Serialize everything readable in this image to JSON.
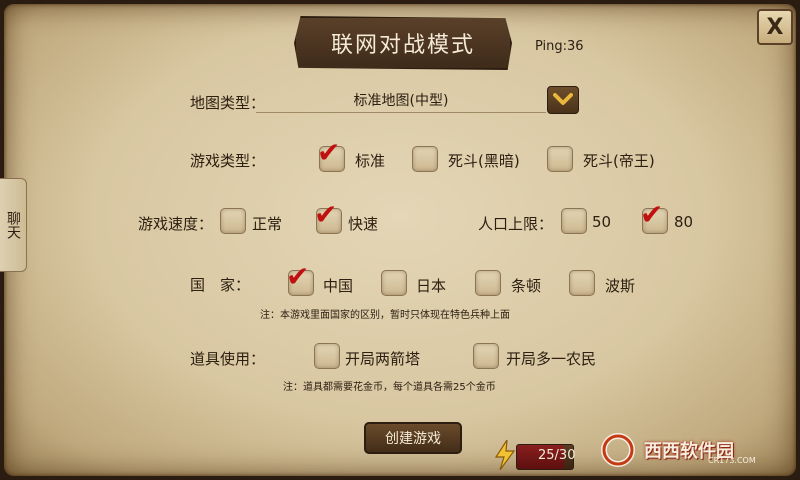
{
  "title": "联网对战模式",
  "ping": "Ping:36",
  "close_label": "X",
  "chat_tab": "聊天",
  "map": {
    "label": "地图类型：",
    "selected": "标准地图(中型)"
  },
  "game_type": {
    "label": "游戏类型：",
    "options": [
      {
        "text": "标准",
        "checked": true
      },
      {
        "text": "死斗(黑暗)",
        "checked": false
      },
      {
        "text": "死斗(帝王)",
        "checked": false
      }
    ]
  },
  "speed": {
    "label": "游戏速度：",
    "options": [
      {
        "text": "正常",
        "checked": false
      },
      {
        "text": "快速",
        "checked": true
      }
    ]
  },
  "population": {
    "label": "人口上限：",
    "options": [
      {
        "text": "50",
        "checked": false
      },
      {
        "text": "80",
        "checked": true
      }
    ]
  },
  "country": {
    "label": "国　家：",
    "options": [
      {
        "text": "中国",
        "checked": true
      },
      {
        "text": "日本",
        "checked": false
      },
      {
        "text": "条顿",
        "checked": false
      },
      {
        "text": "波斯",
        "checked": false
      }
    ],
    "note": "注：本游戏里面国家的区别，暂时只体现在特色兵种上面"
  },
  "items": {
    "label": "道具使用：",
    "options": [
      {
        "text": "开局两箭塔",
        "checked": false
      },
      {
        "text": "开局多一农民",
        "checked": false
      }
    ],
    "note": "注：道具都需要花金币，每个道具各需25个金币"
  },
  "create_button": "创建游戏",
  "stamina": {
    "text": "25/30",
    "current": 25,
    "max": 30
  },
  "watermark": {
    "brand": "西西软件园",
    "site": "CR173.COM"
  }
}
